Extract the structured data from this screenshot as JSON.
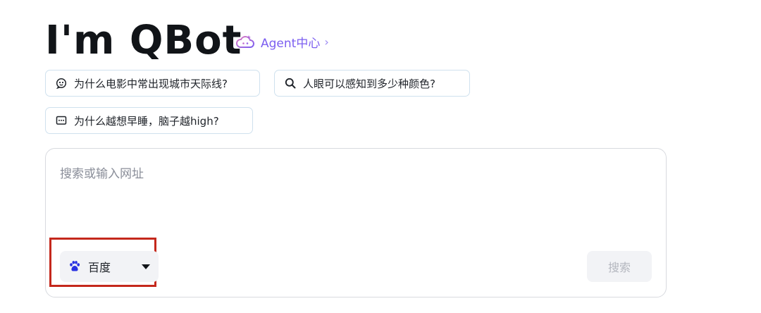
{
  "header": {
    "logo_text": "I'm QBot",
    "agent_link_label": "Agent中心",
    "agent_link_chevron": "›",
    "agent_icon": "cloud-icon"
  },
  "suggestions": [
    {
      "icon": "chat-bubble-icon",
      "text": "为什么电影中常出现城市天际线?"
    },
    {
      "icon": "search-icon",
      "text": "人眼可以感知到多少种颜色?"
    },
    {
      "icon": "message-icon",
      "text": "为什么越想早睡，脑子越high?"
    }
  ],
  "search": {
    "placeholder": "搜索或输入网址",
    "value": "",
    "engine": {
      "icon": "baidu-paw-icon",
      "label": "百度"
    },
    "submit_label": "搜索"
  },
  "colors": {
    "accent": "#7b5ef0",
    "chip_border": "#cfe1ee",
    "highlight": "#c4281c",
    "baidu_blue": "#2932e1"
  }
}
